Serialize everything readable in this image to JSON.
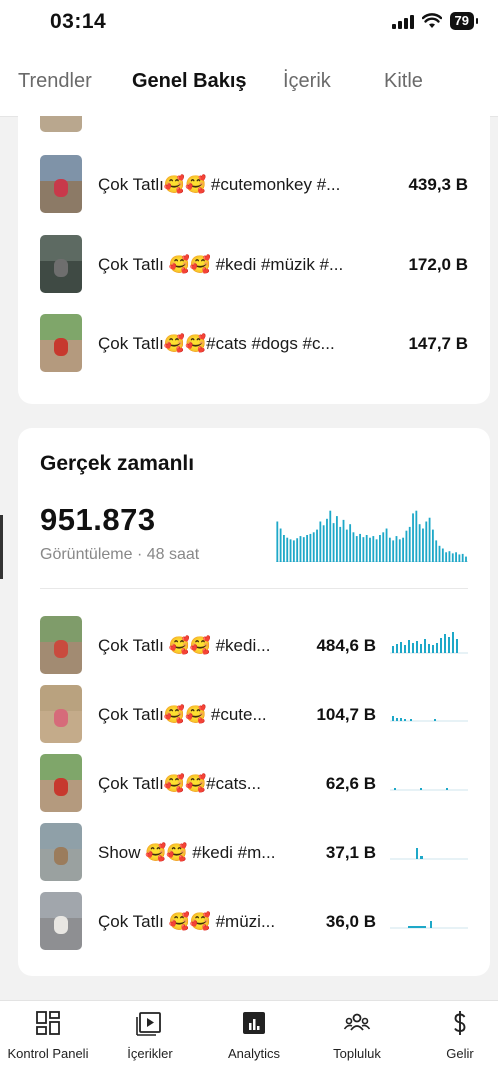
{
  "status": {
    "time": "03:14",
    "battery": "79"
  },
  "tabs": [
    {
      "label": "Trendler"
    },
    {
      "label": "Genel Bakış"
    },
    {
      "label": "İçerik"
    },
    {
      "label": "Kitle"
    }
  ],
  "top_videos": [
    {
      "title": "Çok Tatlı🥰🥰 #cutemonkey #...",
      "views": "439,3 B"
    },
    {
      "title": "Çok Tatlı 🥰🥰 #kedi #müzik #...",
      "views": "172,0 B"
    },
    {
      "title": "Çok Tatlı🥰🥰#cats #dogs  #c...",
      "views": "147,7 B"
    }
  ],
  "realtime": {
    "title": "Gerçek zamanlı",
    "total": "951.873",
    "subtitle": "Görüntüleme · 48 saat",
    "accent_color": "#1ea8c8",
    "items": [
      {
        "title": "Çok Tatlı 🥰🥰 #kedi...",
        "views": "484,6 B"
      },
      {
        "title": "Çok Tatlı🥰🥰 #cute...",
        "views": "104,7 B"
      },
      {
        "title": "Çok Tatlı🥰🥰#cats...",
        "views": "62,6 B"
      },
      {
        "title": "Show 🥰🥰 #kedi #m...",
        "views": "37,1 B"
      },
      {
        "title": "Çok Tatlı 🥰🥰 #müzi...",
        "views": "36,0 B"
      }
    ]
  },
  "nav": [
    {
      "label": "Kontrol Paneli",
      "icon": "dashboard-icon"
    },
    {
      "label": "İçerikler",
      "icon": "video-icon"
    },
    {
      "label": "Analytics",
      "icon": "analytics-icon"
    },
    {
      "label": "Topluluk",
      "icon": "community-icon"
    },
    {
      "label": "Gelir",
      "icon": "dollar-icon"
    }
  ]
}
